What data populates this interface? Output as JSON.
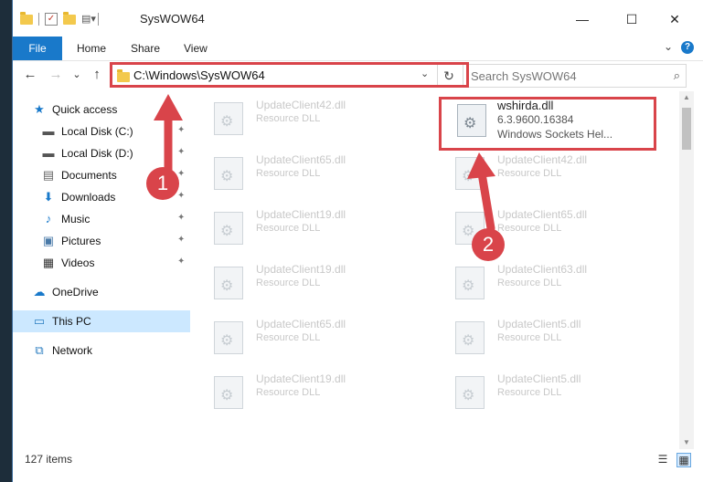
{
  "window": {
    "title": "SysWOW64",
    "controls": {
      "minimize": "—",
      "maximize": "☐",
      "close": "✕"
    }
  },
  "ribbon": {
    "tabs": [
      "File",
      "Home",
      "Share",
      "View"
    ],
    "expand_icon": "chevron-down-icon",
    "help_icon": "help-icon",
    "help_glyph": "?"
  },
  "nav": {
    "back_glyph": "←",
    "forward_glyph": "→",
    "recent_glyph": "⌄",
    "up_glyph": "↑",
    "address": "C:\\Windows\\SysWOW64",
    "refresh_glyph": "↻",
    "search_placeholder": "Search SysWOW64"
  },
  "sidebar": {
    "items": [
      {
        "label": "Quick access",
        "icon": "star-icon",
        "glyph": "★",
        "color": "#1979ca",
        "pinned": false,
        "selected": false
      },
      {
        "label": "Local Disk (C:)",
        "icon": "drive-icon",
        "glyph": "▬",
        "color": "#555555",
        "pinned": true,
        "selected": false
      },
      {
        "label": "Local Disk (D:)",
        "icon": "drive-icon",
        "glyph": "▬",
        "color": "#555555",
        "pinned": true,
        "selected": false
      },
      {
        "label": "Documents",
        "icon": "documents-icon",
        "glyph": "▤",
        "color": "#666666",
        "pinned": true,
        "selected": false
      },
      {
        "label": "Downloads",
        "icon": "download-icon",
        "glyph": "⬇",
        "color": "#1979ca",
        "pinned": true,
        "selected": false
      },
      {
        "label": "Music",
        "icon": "music-icon",
        "glyph": "♪",
        "color": "#1979ca",
        "pinned": true,
        "selected": false
      },
      {
        "label": "Pictures",
        "icon": "pictures-icon",
        "glyph": "▣",
        "color": "#4a7aa8",
        "pinned": true,
        "selected": false
      },
      {
        "label": "Videos",
        "icon": "videos-icon",
        "glyph": "▦",
        "color": "#333333",
        "pinned": true,
        "selected": false
      },
      {
        "label": "OneDrive",
        "icon": "cloud-icon",
        "glyph": "☁",
        "color": "#1979ca",
        "pinned": false,
        "selected": false
      },
      {
        "label": "This PC",
        "icon": "computer-icon",
        "glyph": "▭",
        "color": "#2d7fc1",
        "pinned": false,
        "selected": true
      },
      {
        "label": "Network",
        "icon": "network-icon",
        "glyph": "⧉",
        "color": "#2d7fc1",
        "pinned": false,
        "selected": false
      }
    ],
    "pin_glyph": "📌"
  },
  "files": {
    "left_column": [
      {
        "name": "UpdateClient42.dll",
        "desc": "Resource DLL"
      },
      {
        "name": "UpdateClient65.dll",
        "desc": "Resource DLL"
      },
      {
        "name": "UpdateClient19.dll",
        "desc": "Resource DLL"
      },
      {
        "name": "UpdateClient19.dll",
        "desc": "Resource DLL"
      },
      {
        "name": "UpdateClient65.dll",
        "desc": "Resource DLL"
      },
      {
        "name": "UpdateClient19.dll",
        "desc": "Resource DLL"
      }
    ],
    "highlighted": {
      "name": "wshirda.dll",
      "version": "6.3.9600.16384",
      "desc": "Windows Sockets Hel..."
    },
    "right_column": [
      {
        "name": "UpdateClient42.dll",
        "desc": "Resource DLL"
      },
      {
        "name": "UpdateClient65.dll",
        "desc": "Resource DLL"
      },
      {
        "name": "UpdateClient63.dll",
        "desc": "Resource DLL"
      },
      {
        "name": "UpdateClient5.dll",
        "desc": "Resource DLL"
      },
      {
        "name": "UpdateClient5.dll",
        "desc": "Resource DLL"
      }
    ]
  },
  "status": {
    "items_count": "127 items"
  },
  "annotations": {
    "step1": "1",
    "step2": "2",
    "color": "#d9444a"
  }
}
